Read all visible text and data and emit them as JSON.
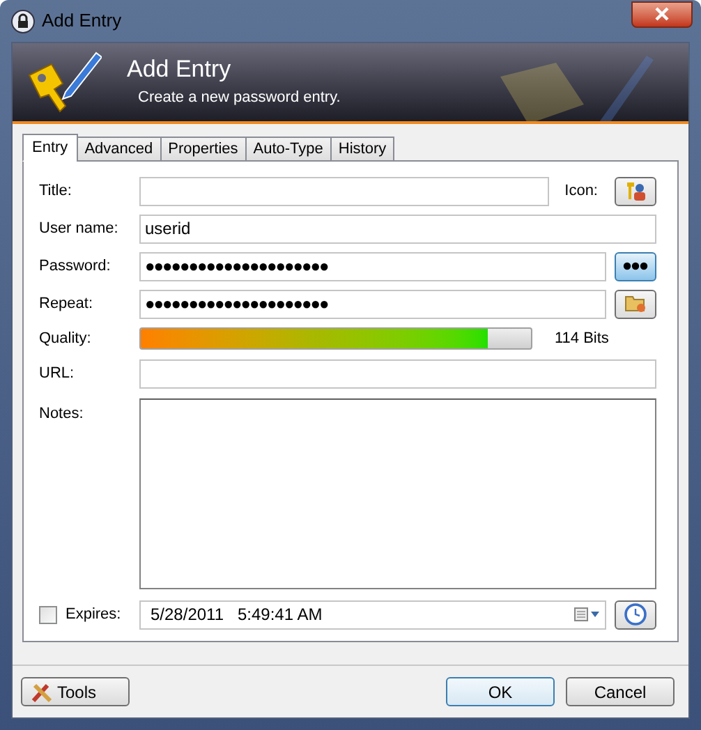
{
  "window": {
    "title": "Add Entry"
  },
  "header": {
    "title": "Add Entry",
    "subtitle": "Create a new password entry."
  },
  "tabs": [
    {
      "label": "Entry",
      "selected": true
    },
    {
      "label": "Advanced",
      "selected": false
    },
    {
      "label": "Properties",
      "selected": false
    },
    {
      "label": "Auto-Type",
      "selected": false
    },
    {
      "label": "History",
      "selected": false
    }
  ],
  "form": {
    "title": {
      "label": "Title:"
    },
    "icon_label": "Icon:",
    "user_name": {
      "label": "User name:",
      "value": "userid"
    },
    "password": {
      "label": "Password:",
      "value": "●●●●●●●●●●●●●●●●●●●●●",
      "toggle_pressed": true
    },
    "repeat": {
      "label": "Repeat:",
      "value": "●●●●●●●●●●●●●●●●●●●●●"
    },
    "quality": {
      "label": "Quality:",
      "level": 0.89,
      "reading": "114 Bits"
    },
    "url": {
      "label": "URL:"
    },
    "notes": {
      "label": "Notes:"
    },
    "expires": {
      "label": "Expires:",
      "checked": false,
      "value": "5/28/2011   5:49:41 AM"
    }
  },
  "buttons": {
    "tools": "Tools",
    "ok": "OK",
    "cancel": "Cancel"
  }
}
